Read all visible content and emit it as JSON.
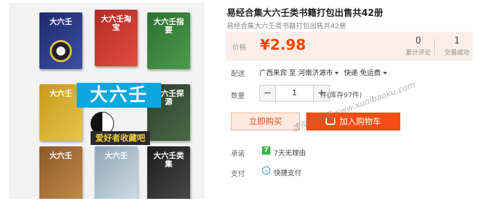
{
  "gallery": {
    "overlay_title": "大六壬",
    "overlay_subtitle": "爱好者收藏吧",
    "books": [
      {
        "title": "大六壬"
      },
      {
        "title": "大六壬淘宝"
      },
      {
        "title": "大六壬指要"
      },
      {
        "title": "大六壬"
      },
      {
        "title": "大六壬探源"
      },
      {
        "title": "大六壬"
      },
      {
        "title": "大六壬"
      },
      {
        "title": "大六壬类集"
      }
    ]
  },
  "product": {
    "title": "易经合集大六壬类书籍打包出售共42册",
    "subtitle": "易经合集大六壬类书籍打包出售共42册"
  },
  "price": {
    "label": "价格",
    "value": "¥2.98"
  },
  "stats": [
    {
      "num": "0",
      "label": "累计评论"
    },
    {
      "num": "1",
      "label": "交易成功"
    }
  ],
  "shipping": {
    "label": "配送",
    "from": "广西来宾 至",
    "to": "河南济源市",
    "method": "快递 免运费"
  },
  "quantity": {
    "label": "数量",
    "minus": "−",
    "value": "1",
    "plus": "+",
    "stock": "件(库存97件)"
  },
  "actions": {
    "buy_now": "立即购买",
    "add_to_cart": "加入购物车"
  },
  "promise": {
    "label": "承诺",
    "badge": "7",
    "text": "7天无理由"
  },
  "payment": {
    "label": "支付",
    "text": "快捷支付"
  },
  "watermark": "虚拟宝库网 www.xunibaoku.com"
}
